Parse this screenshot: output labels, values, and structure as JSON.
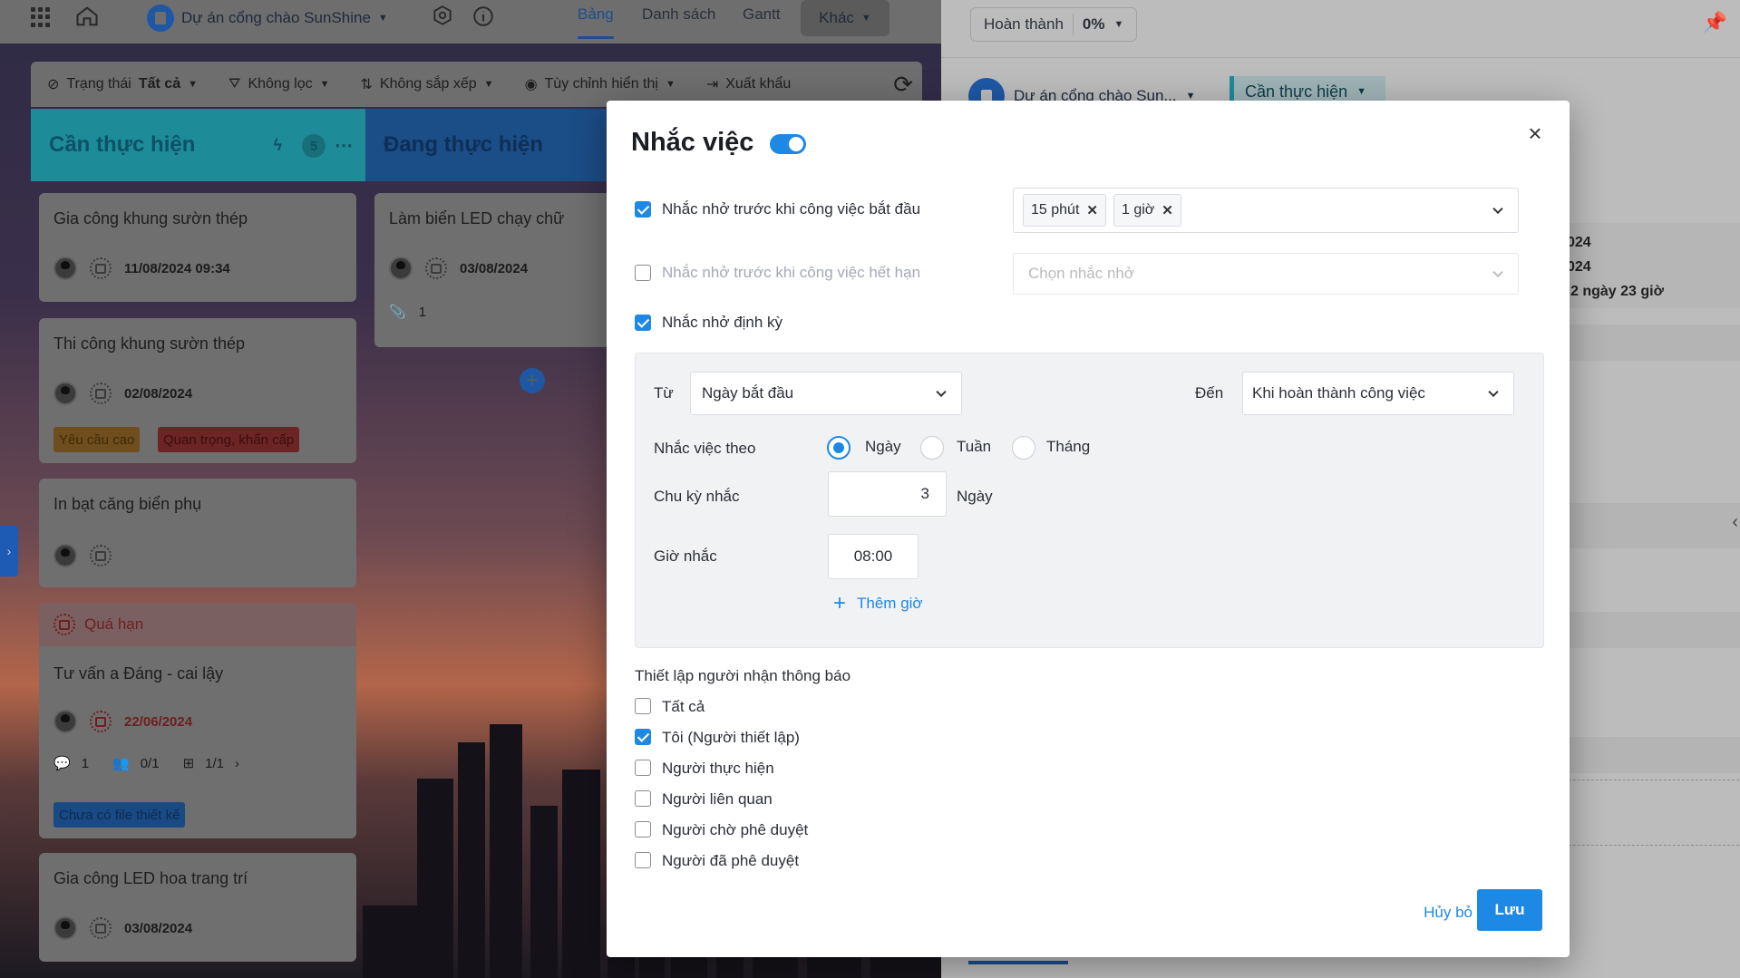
{
  "nav": {
    "project_name": "Dự án cổng chào SunShine",
    "tabs": [
      "Bảng",
      "Danh sách",
      "Gantt"
    ],
    "more_label": "Khác"
  },
  "toolbar": {
    "status_label": "Trạng thái",
    "status_value": "Tất cả",
    "filter_label": "Không lọc",
    "sort_label": "Không sắp xếp",
    "display_label": "Tùy chỉnh hiển thị",
    "export_label": "Xuất khẩu"
  },
  "columns": [
    {
      "title": "Cần thực hiện",
      "count": "5"
    },
    {
      "title": "Đang thực hiện"
    }
  ],
  "cards": [
    {
      "title": "Gia công khung sườn thép",
      "date": "11/08/2024 09:34"
    },
    {
      "title": "Thi công khung sườn thép",
      "date": "02/08/2024",
      "tags": [
        "Yêu cầu cao",
        "Quan trọng, khẩn cấp"
      ]
    },
    {
      "title": "In bạt căng biển phụ"
    },
    {
      "overdue_label": "Quá hạn",
      "title": "Tư vấn a Đáng - cai lậy",
      "date": "22/06/2024",
      "comments": "1",
      "assignees": "0/1",
      "subtasks": "1/1",
      "tags": [
        "Chưa có file thiết kế"
      ]
    },
    {
      "title": "Gia công LED hoa trang trí",
      "date": "03/08/2024"
    },
    {
      "title": "Làm biển LED chạy chữ",
      "date": "03/08/2024",
      "attachments": "1"
    }
  ],
  "right_panel": {
    "completion_label": "Hoàn thành",
    "completion_value": "0%",
    "project_short": "Dự án cổng chào Sun...",
    "status": "Cần thực hiện",
    "date1": "024",
    "date2": "024",
    "duration": "2 ngày 23 giờ"
  },
  "modal": {
    "title": "Nhắc việc",
    "enabled": true,
    "remind_before_start": {
      "label": "Nhắc nhở trước khi công việc bắt đầu",
      "checked": true,
      "chips": [
        "15 phút",
        "1 giờ"
      ]
    },
    "remind_before_due": {
      "label": "Nhắc nhở trước khi công việc hết hạn",
      "checked": false,
      "placeholder": "Chọn nhắc nhở"
    },
    "periodic": {
      "label": "Nhắc nhở định kỳ",
      "checked": true,
      "from_label": "Từ",
      "from_value": "Ngày bắt đầu",
      "to_label": "Đến",
      "to_value": "Khi hoàn thành công việc",
      "by_label": "Nhắc việc theo",
      "options": [
        "Ngày",
        "Tuần",
        "Tháng"
      ],
      "selected": "Ngày",
      "cycle_label": "Chu kỳ nhắc",
      "cycle_value": "3",
      "cycle_unit": "Ngày",
      "time_label": "Giờ nhắc",
      "time_value": "08:00",
      "add_time": "Thêm giờ"
    },
    "recipients_title": "Thiết lập người nhận thông báo",
    "recipients": [
      {
        "label": "Tất cả",
        "checked": false
      },
      {
        "label": "Tôi (Người thiết lập)",
        "checked": true
      },
      {
        "label": "Người thực hiện",
        "checked": false
      },
      {
        "label": "Người liên quan",
        "checked": false
      },
      {
        "label": "Người chờ phê duyệt",
        "checked": false
      },
      {
        "label": "Người đã phê duyệt",
        "checked": false
      }
    ],
    "cancel_label": "Hủy bỏ",
    "save_label": "Lưu"
  },
  "colors": {
    "accent": "#1e88e5",
    "overlay": "rgba(0,0,0,0.45)"
  }
}
